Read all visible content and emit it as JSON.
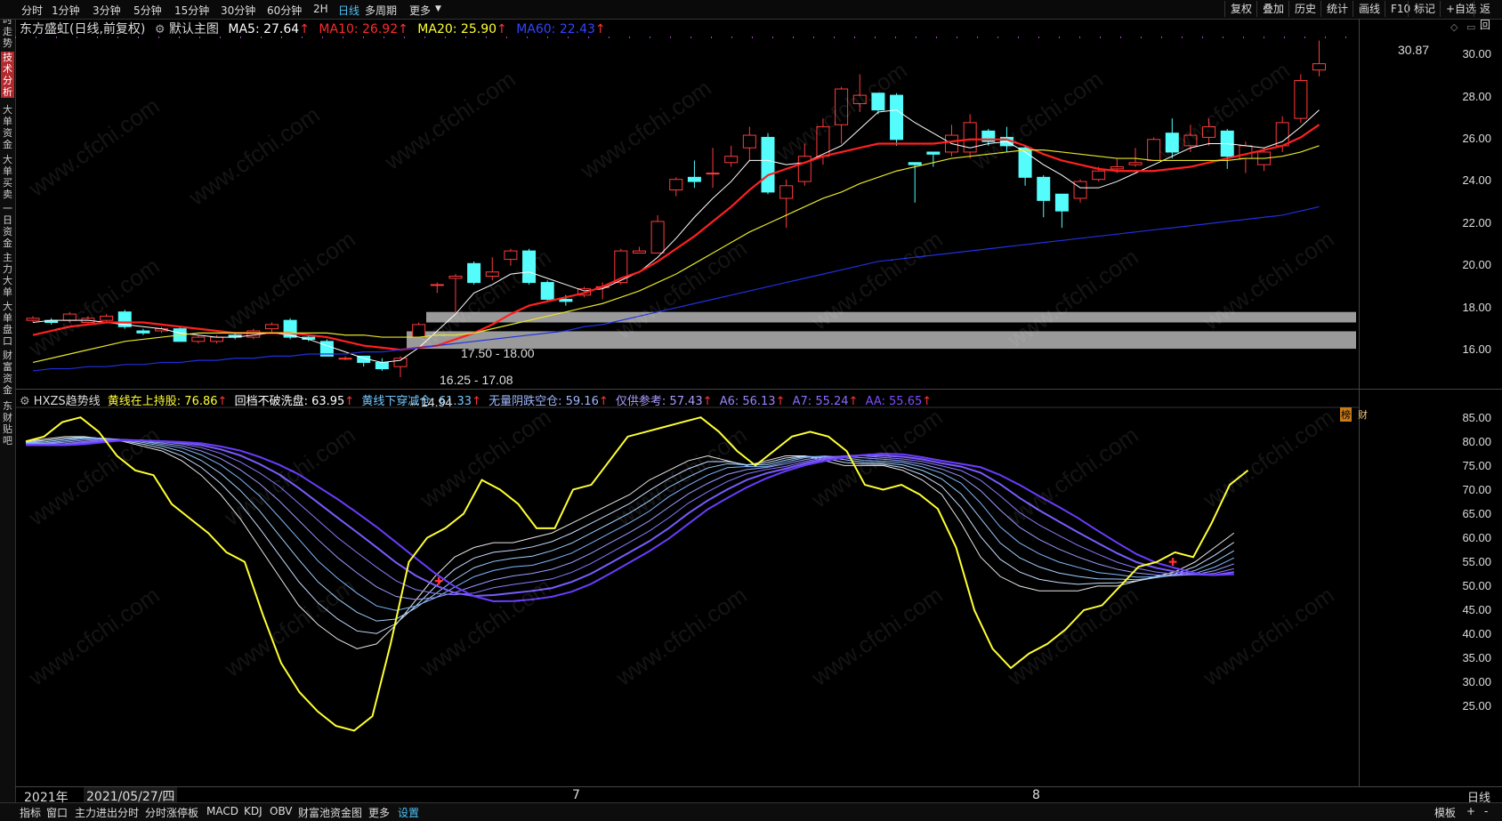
{
  "toolbar": {
    "periods": [
      "分时",
      "1分钟",
      "3分钟",
      "5分钟",
      "15分钟",
      "30分钟",
      "60分钟",
      "2H",
      "日线",
      "多周期",
      "更多"
    ],
    "active_period": "日线",
    "right_buttons": [
      "复权",
      "叠加",
      "历史",
      "统计",
      "画线",
      "F10",
      "标记",
      "+自选",
      "返回"
    ]
  },
  "sidebar": {
    "tabs": [
      "分时走势",
      "技术分析",
      "大单资金",
      "大单买卖",
      "一日资金",
      "主力大单",
      "大单盘口",
      "财富资金",
      "东财贴吧"
    ],
    "active": "技术分析"
  },
  "main_info": {
    "stock": "东方盛虹(日线,前复权)",
    "template": "默认主图",
    "ma5": "MA5: 27.64",
    "ma10": "MA10: 26.92",
    "ma20": "MA20: 25.90",
    "ma60": "MA60: 22.43",
    "colors": {
      "ma5": "#ffffff",
      "ma10": "#ff2a2a",
      "ma20": "#ffff33",
      "ma60": "#2a3cff"
    }
  },
  "main_axis": [
    "30.00",
    "28.00",
    "26.00",
    "24.00",
    "22.00",
    "20.00",
    "18.00",
    "16.00"
  ],
  "annotations": {
    "high": "30.87",
    "low": "←14.94",
    "zone1": "17.50 - 18.00",
    "zone2": "16.25 - 17.08",
    "badges": [
      "榜",
      "财"
    ]
  },
  "indicator_info": {
    "name": "HXZS趋势线",
    "items": [
      {
        "text": "黄线在上持股: 76.86",
        "color": "#ffff33"
      },
      {
        "text": "回档不破洗盘: 63.95",
        "color": "#ffffff"
      },
      {
        "text": "黄线下穿减仓: 61.33",
        "color": "#74c7ff"
      },
      {
        "text": "无量阴跌空仓: 59.16",
        "color": "#9fb7ff"
      },
      {
        "text": "仅供参考: 57.43",
        "color": "#a89cff"
      },
      {
        "text": "A6: 56.13",
        "color": "#9b84ff"
      },
      {
        "text": "A7: 55.24",
        "color": "#8d6bff"
      },
      {
        "text": "AA: 55.65",
        "color": "#7b4dff"
      }
    ]
  },
  "indicator_axis": [
    "85.00",
    "80.00",
    "75.00",
    "70.00",
    "65.00",
    "60.00",
    "55.00",
    "50.00",
    "45.00",
    "40.00",
    "35.00",
    "30.00",
    "25.00"
  ],
  "date_bar": {
    "year": "2021年",
    "cursor_date": "2021/05/27/四",
    "month1": "7",
    "month2": "8",
    "right": "日线"
  },
  "bottom_tabs": [
    "指标",
    "窗口",
    "主力进出分时",
    "分时涨停板",
    "MACD",
    "KDJ",
    "OBV",
    "财富池资金图",
    "更多",
    "设置"
  ],
  "bottom_active": "设置",
  "bottom_right": [
    "模板",
    "+",
    "-"
  ],
  "watermark": "www.cfchi.com",
  "candles": [
    [
      17.6,
      17.7,
      17.5,
      17.8
    ],
    [
      17.6,
      17.5,
      17.4,
      17.7
    ],
    [
      17.6,
      17.9,
      17.5,
      18.0
    ],
    [
      17.5,
      17.7,
      17.4,
      17.8
    ],
    [
      17.6,
      17.8,
      17.5,
      17.9
    ],
    [
      18.0,
      17.3,
      17.2,
      18.1
    ],
    [
      17.1,
      17.0,
      16.9,
      17.2
    ],
    [
      17.1,
      17.2,
      17.0,
      17.3
    ],
    [
      17.2,
      16.6,
      16.6,
      17.3
    ],
    [
      16.6,
      16.8,
      16.5,
      16.9
    ],
    [
      16.6,
      16.8,
      16.5,
      16.9
    ],
    [
      16.9,
      16.8,
      16.7,
      17.0
    ],
    [
      16.8,
      17.1,
      16.7,
      17.2
    ],
    [
      17.2,
      17.4,
      17.0,
      17.5
    ],
    [
      17.6,
      16.8,
      16.7,
      17.7
    ],
    [
      16.8,
      16.7,
      16.6,
      16.9
    ],
    [
      16.6,
      15.9,
      15.9,
      16.7
    ],
    [
      15.8,
      15.8,
      15.7,
      15.9
    ],
    [
      15.9,
      15.6,
      15.4,
      15.9
    ],
    [
      15.6,
      15.3,
      15.2,
      15.8
    ],
    [
      15.4,
      15.8,
      14.9,
      15.9
    ],
    [
      16.8,
      17.4,
      16.8,
      17.5
    ],
    [
      19.3,
      19.3,
      18.9,
      19.4
    ],
    [
      19.6,
      19.7,
      17.9,
      19.8
    ],
    [
      20.3,
      19.4,
      19.3,
      20.4
    ],
    [
      19.7,
      19.9,
      19.5,
      20.6
    ],
    [
      20.5,
      20.9,
      20.2,
      21.0
    ],
    [
      20.9,
      19.4,
      19.3,
      21.0
    ],
    [
      19.4,
      18.6,
      18.5,
      19.5
    ],
    [
      18.6,
      18.5,
      18.3,
      18.8
    ],
    [
      18.8,
      19.1,
      18.7,
      19.2
    ],
    [
      19.2,
      19.2,
      18.6,
      19.4
    ],
    [
      19.4,
      20.9,
      19.3,
      21.0
    ],
    [
      20.8,
      20.9,
      20.8,
      21.1
    ],
    [
      20.8,
      22.3,
      20.8,
      22.6
    ],
    [
      23.8,
      24.3,
      23.5,
      24.4
    ],
    [
      24.4,
      24.2,
      23.9,
      25.2
    ],
    [
      24.6,
      24.6,
      23.9,
      25.8
    ],
    [
      25.1,
      25.4,
      24.9,
      25.9
    ],
    [
      25.8,
      26.4,
      25.2,
      26.8
    ],
    [
      26.3,
      23.7,
      23.6,
      26.5
    ],
    [
      23.4,
      24.0,
      22.0,
      24.3
    ],
    [
      24.2,
      25.4,
      24.0,
      26.0
    ],
    [
      25.4,
      26.8,
      25.0,
      27.2
    ],
    [
      26.9,
      28.6,
      26.0,
      28.7
    ],
    [
      27.9,
      28.3,
      27.5,
      29.3
    ],
    [
      28.4,
      27.6,
      27.4,
      28.4
    ],
    [
      28.3,
      26.2,
      25.9,
      28.4
    ],
    [
      25.1,
      25.0,
      23.2,
      25.1
    ],
    [
      25.6,
      25.5,
      24.9,
      25.6
    ],
    [
      25.6,
      26.4,
      25.4,
      26.9
    ],
    [
      25.6,
      27.0,
      25.3,
      27.4
    ],
    [
      26.6,
      26.1,
      25.9,
      26.7
    ],
    [
      26.3,
      25.9,
      25.6,
      26.8
    ],
    [
      25.8,
      24.4,
      24.0,
      25.9
    ],
    [
      24.4,
      23.3,
      22.5,
      24.5
    ],
    [
      23.6,
      22.8,
      22.0,
      23.6
    ],
    [
      23.4,
      24.2,
      23.2,
      24.3
    ],
    [
      24.3,
      24.7,
      24.2,
      24.9
    ],
    [
      24.8,
      24.9,
      24.6,
      25.3
    ],
    [
      25.0,
      25.1,
      24.9,
      25.8
    ],
    [
      25.2,
      26.2,
      25.2,
      26.3
    ],
    [
      26.5,
      25.6,
      25.3,
      27.2
    ],
    [
      25.9,
      26.4,
      25.6,
      26.9
    ],
    [
      26.3,
      26.8,
      25.9,
      27.2
    ],
    [
      26.6,
      25.4,
      24.8,
      26.7
    ],
    [
      25.3,
      25.9,
      24.6,
      26.1
    ],
    [
      25.0,
      25.6,
      24.7,
      25.8
    ],
    [
      25.9,
      27.0,
      25.6,
      27.3
    ],
    [
      27.2,
      29.0,
      27.0,
      29.3
    ],
    [
      29.5,
      29.8,
      29.2,
      30.9
    ]
  ],
  "ma_series": {
    "ma5": [
      17.5,
      17.6,
      17.6,
      17.6,
      17.5,
      17.4,
      17.3,
      17.2,
      17.0,
      16.9,
      16.8,
      16.8,
      16.9,
      17.0,
      16.9,
      16.7,
      16.4,
      16.1,
      15.8,
      15.6,
      15.7,
      16.3,
      17.1,
      17.9,
      18.9,
      19.3,
      19.8,
      19.9,
      19.6,
      19.3,
      19.0,
      19.1,
      19.5,
      19.9,
      20.6,
      21.5,
      22.5,
      23.4,
      24.2,
      25.2,
      25.2,
      25.0,
      25.1,
      25.5,
      25.9,
      26.7,
      27.5,
      27.6,
      27.0,
      26.5,
      26.0,
      25.8,
      26.0,
      26.1,
      25.6,
      25.0,
      24.5,
      23.9,
      23.9,
      24.2,
      24.6,
      25.0,
      25.4,
      25.8,
      26.0,
      26.0,
      25.9,
      25.8,
      26.1,
      26.8,
      27.6
    ],
    "ma10": [
      16.9,
      17.1,
      17.3,
      17.4,
      17.5,
      17.5,
      17.5,
      17.4,
      17.3,
      17.2,
      17.1,
      17.0,
      17.0,
      17.0,
      17.0,
      16.9,
      16.8,
      16.6,
      16.4,
      16.3,
      16.2,
      16.3,
      16.4,
      16.7,
      17.0,
      17.4,
      17.9,
      18.3,
      18.5,
      18.7,
      18.9,
      19.2,
      19.6,
      19.9,
      20.4,
      21.0,
      21.6,
      22.3,
      23.0,
      23.8,
      24.5,
      24.8,
      25.1,
      25.4,
      25.6,
      25.8,
      26.0,
      26.0,
      26.0,
      26.0,
      26.1,
      26.2,
      26.2,
      26.2,
      25.9,
      25.5,
      25.2,
      25.0,
      24.8,
      24.7,
      24.7,
      24.7,
      24.8,
      24.9,
      25.1,
      25.3,
      25.5,
      25.7,
      25.9,
      26.3,
      26.9
    ],
    "ma20": [
      15.6,
      15.8,
      16.0,
      16.2,
      16.4,
      16.6,
      16.7,
      16.8,
      16.9,
      17.0,
      17.0,
      17.0,
      17.0,
      17.0,
      17.0,
      17.0,
      17.0,
      16.9,
      16.9,
      16.8,
      16.8,
      16.8,
      16.9,
      16.9,
      17.0,
      17.2,
      17.4,
      17.6,
      17.8,
      18.0,
      18.2,
      18.4,
      18.7,
      19.0,
      19.4,
      19.8,
      20.3,
      20.8,
      21.3,
      21.8,
      22.2,
      22.6,
      23.0,
      23.4,
      23.7,
      24.1,
      24.4,
      24.7,
      24.9,
      25.1,
      25.3,
      25.4,
      25.5,
      25.6,
      25.7,
      25.7,
      25.6,
      25.5,
      25.4,
      25.3,
      25.3,
      25.2,
      25.2,
      25.2,
      25.2,
      25.2,
      25.3,
      25.3,
      25.4,
      25.6,
      25.9
    ],
    "ma60": [
      15.2,
      15.3,
      15.3,
      15.4,
      15.4,
      15.5,
      15.5,
      15.6,
      15.6,
      15.7,
      15.7,
      15.8,
      15.8,
      15.9,
      15.9,
      16.0,
      16.0,
      16.0,
      16.1,
      16.1,
      16.2,
      16.3,
      16.4,
      16.5,
      16.6,
      16.7,
      16.8,
      16.9,
      17.0,
      17.1,
      17.3,
      17.4,
      17.6,
      17.8,
      18.0,
      18.2,
      18.4,
      18.6,
      18.8,
      19.0,
      19.2,
      19.4,
      19.6,
      19.8,
      20.0,
      20.2,
      20.4,
      20.5,
      20.6,
      20.7,
      20.8,
      20.9,
      21.0,
      21.1,
      21.2,
      21.3,
      21.4,
      21.5,
      21.6,
      21.7,
      21.8,
      21.9,
      22.0,
      22.1,
      22.2,
      22.3,
      22.4,
      22.5,
      22.6,
      22.8,
      23.0
    ]
  },
  "indicator_series": {
    "yellow": [
      82,
      83,
      86,
      87,
      84,
      79,
      76,
      75,
      69,
      66,
      63,
      59,
      57,
      46,
      36,
      30,
      26,
      23,
      22,
      25,
      40,
      57,
      62,
      64,
      67,
      74,
      72,
      69,
      64,
      64,
      72,
      73,
      78,
      83,
      84,
      85,
      86,
      87,
      84,
      80,
      77,
      80,
      83,
      84,
      83,
      80,
      73,
      72,
      73,
      71,
      68,
      60,
      47,
      39,
      35,
      38,
      40,
      43,
      47,
      48,
      52,
      56,
      57,
      59,
      58,
      65,
      73,
      76
    ],
    "ma_w": [
      82,
      82.5,
      83,
      83,
      82.5,
      82,
      81,
      80,
      78,
      75,
      71,
      66,
      60,
      54,
      48,
      44,
      41,
      39,
      40,
      44,
      49,
      54,
      58,
      60,
      61,
      61,
      62,
      63,
      65,
      67,
      69,
      71,
      74,
      76,
      78,
      79,
      78,
      77,
      78,
      79,
      79,
      78,
      77,
      77,
      77,
      76,
      74,
      71,
      65,
      58,
      54,
      52,
      51,
      51,
      51,
      52,
      52,
      53,
      54,
      55,
      57,
      60,
      63
    ],
    "ma_p": [
      81,
      81.5,
      82,
      82,
      82,
      82,
      81.5,
      81,
      80,
      79,
      77,
      75,
      72,
      68,
      63,
      57,
      51,
      47,
      46,
      46,
      47,
      49,
      52,
      55,
      58,
      62,
      66,
      69,
      72,
      75,
      77,
      78,
      79,
      80,
      80,
      79,
      78,
      78,
      77,
      76,
      74,
      71,
      67,
      63,
      59,
      57,
      55,
      54,
      54,
      54,
      55
    ]
  }
}
